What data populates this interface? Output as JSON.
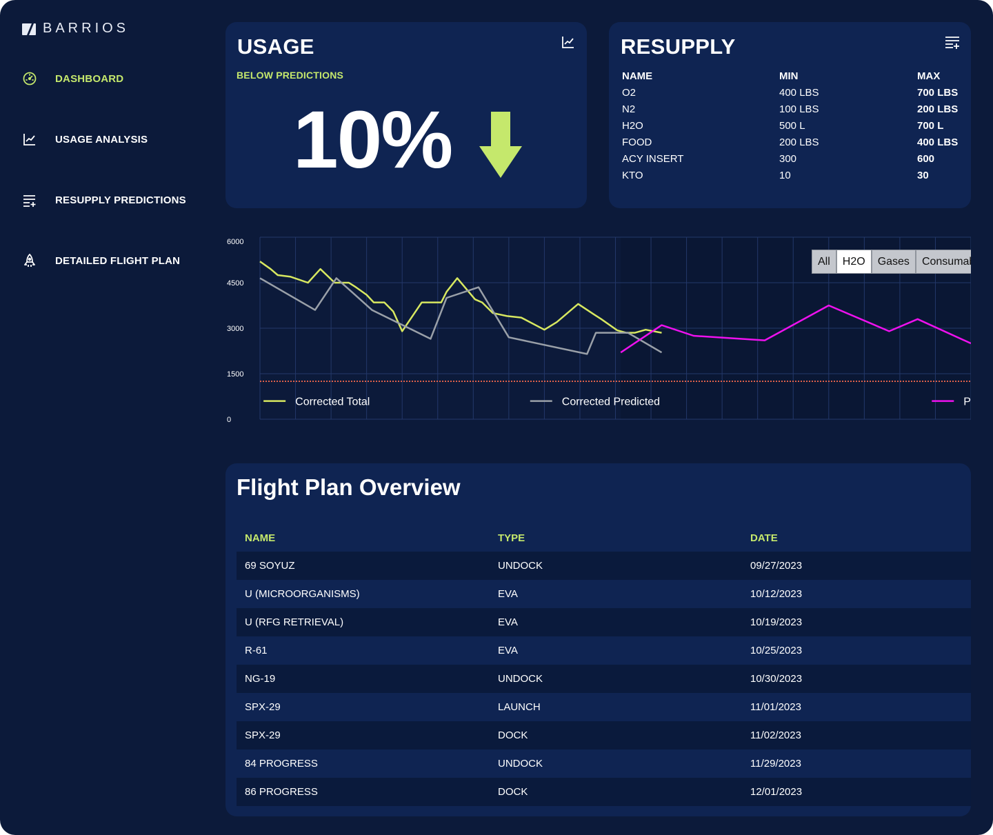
{
  "brand": {
    "name": "BARRIOS"
  },
  "colors": {
    "background": "#0c1a3a",
    "card": "#0f2452",
    "accent": "#c5e86c",
    "corrected_total": "#d8e860",
    "corrected_predicted": "#9aa0a8",
    "predicted": "#ee11ee",
    "threshold": "#e0614a"
  },
  "sidebar": {
    "items": [
      {
        "label": "DASHBOARD",
        "icon": "gauge-icon",
        "active": true
      },
      {
        "label": "USAGE ANALYSIS",
        "icon": "line-chart-icon",
        "active": false
      },
      {
        "label": "RESUPPLY PREDICTIONS",
        "icon": "list-add-icon",
        "active": false
      },
      {
        "label": "DETAILED FLIGHT PLAN",
        "icon": "rocket-icon",
        "active": false
      }
    ]
  },
  "usage": {
    "title": "USAGE",
    "subtitle": "BELOW PREDICTIONS",
    "value": "10%",
    "trend": "down",
    "action_icon": "line-chart-icon"
  },
  "resupply": {
    "title": "RESUPPLY",
    "action_icon": "list-add-icon",
    "columns": [
      "NAME",
      "MIN",
      "MAX"
    ],
    "rows": [
      [
        "O2",
        "400 LBS",
        "700 LBS"
      ],
      [
        "N2",
        "100 LBS",
        "200 LBS"
      ],
      [
        "H2O",
        "500 L",
        "700 L"
      ],
      [
        "FOOD",
        "200 LBS",
        "400 LBS"
      ],
      [
        "ACY INSERT",
        "300",
        "600"
      ],
      [
        "KTO",
        "10",
        "30"
      ]
    ]
  },
  "chart_tabs": [
    {
      "label": "All",
      "selected": false
    },
    {
      "label": "H2O",
      "selected": true
    },
    {
      "label": "Gases",
      "selected": false
    },
    {
      "label": "Consumables",
      "selected": false
    }
  ],
  "chart_data": {
    "type": "line",
    "title": "",
    "xlabel": "",
    "ylabel": "",
    "ylim": [
      0,
      6000
    ],
    "yticks": [
      "6000",
      "4500",
      "3000",
      "1500",
      "0"
    ],
    "xlim": [
      0,
      20
    ],
    "grid": true,
    "legend": "bottom",
    "threshold": 1250,
    "series": [
      {
        "name": "Corrected Total",
        "color": "#d8e860",
        "x": [
          0,
          0.3,
          0.5,
          0.85,
          1.35,
          1.7,
          2.1,
          2.5,
          2.7,
          3.0,
          3.2,
          3.5,
          3.75,
          4.0,
          4.55,
          4.9,
          5.1,
          5.25,
          5.55,
          6.05,
          6.25,
          6.55,
          6.75,
          6.95,
          7.35,
          8.0,
          8.35,
          8.95,
          9.4,
          9.6,
          10.05,
          10.3,
          10.55,
          10.85,
          11.3
        ],
        "y": [
          5200,
          4950,
          4750,
          4700,
          4500,
          4950,
          4500,
          4500,
          4350,
          4100,
          3850,
          3850,
          3550,
          2900,
          3850,
          3850,
          3850,
          4200,
          4650,
          3950,
          3850,
          3500,
          3450,
          3400,
          3350,
          2950,
          3200,
          3800,
          3450,
          3300,
          2930,
          2850,
          2850,
          2950,
          2850
        ]
      },
      {
        "name": "Corrected Predicted",
        "color": "#9aa0a8",
        "x": [
          0,
          1.55,
          2.15,
          3.15,
          4.8,
          5.25,
          6.15,
          7.0,
          9.2,
          9.45,
          10.15,
          10.35,
          11.3
        ],
        "y": [
          4650,
          3600,
          4650,
          3600,
          2650,
          4000,
          4350,
          2700,
          2150,
          2850,
          2850,
          2850,
          2200
        ]
      },
      {
        "name": "Predicted",
        "color": "#ee11ee",
        "x": [
          10.15,
          11.3,
          12.2,
          14.2,
          16.0,
          17.7,
          18.5,
          20.0
        ],
        "y": [
          2200,
          3100,
          2750,
          2600,
          3750,
          2900,
          3300,
          2500
        ]
      }
    ]
  },
  "flight_plan": {
    "title": "Flight Plan Overview",
    "columns": [
      "NAME",
      "TYPE",
      "DATE"
    ],
    "rows": [
      [
        "69 SOYUZ",
        "UNDOCK",
        "09/27/2023"
      ],
      [
        "U (MICROORGANISMS)",
        "EVA",
        "10/12/2023"
      ],
      [
        "U (RFG RETRIEVAL)",
        "EVA",
        "10/19/2023"
      ],
      [
        "R-61",
        "EVA",
        "10/25/2023"
      ],
      [
        "NG-19",
        "UNDOCK",
        "10/30/2023"
      ],
      [
        "SPX-29",
        "LAUNCH",
        "11/01/2023"
      ],
      [
        "SPX-29",
        "DOCK",
        "11/02/2023"
      ],
      [
        "84 PROGRESS",
        "UNDOCK",
        "11/29/2023"
      ],
      [
        "86 PROGRESS",
        "DOCK",
        "12/01/2023"
      ]
    ]
  }
}
